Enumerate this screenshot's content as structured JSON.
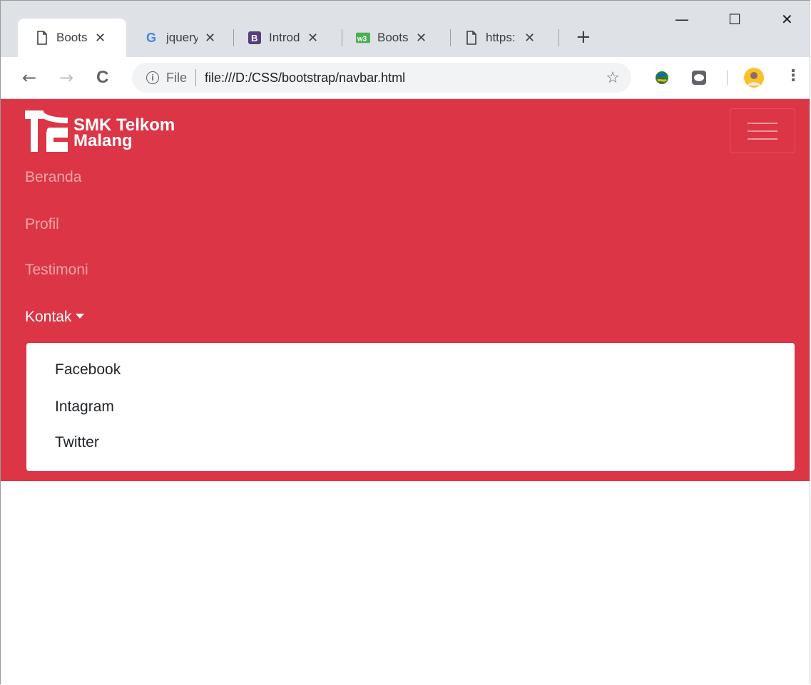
{
  "browser": {
    "tabs": [
      {
        "label": "Boots",
        "icon": "page-icon",
        "active": true
      },
      {
        "label": "jquery",
        "icon": "google-icon",
        "active": false
      },
      {
        "label": "Introd",
        "icon": "bootstrap-icon",
        "active": false
      },
      {
        "label": "Boots",
        "icon": "w3schools-icon",
        "active": false
      },
      {
        "label": "https:",
        "icon": "page-icon",
        "active": false
      }
    ],
    "tab_close": "✕",
    "new_tab": "+",
    "window_controls": {
      "minimize": "—",
      "maximize": "☐",
      "close": "✕"
    },
    "toolbar": {
      "back": "←",
      "forward": "→",
      "reload": "C",
      "info": "i",
      "scheme_label": "File",
      "url": "file:///D:/CSS/bootstrap/navbar.html",
      "bookmark": "☆",
      "menu": "⋮"
    }
  },
  "page": {
    "brand": {
      "line1": "SMK Telkom",
      "line2": "Malang"
    },
    "nav": [
      {
        "label": "Beranda",
        "active": false
      },
      {
        "label": "Profil",
        "active": false
      },
      {
        "label": "Testimoni",
        "active": false
      },
      {
        "label": "Kontak",
        "active": true
      }
    ],
    "dropdown": [
      "Facebook",
      "Intagram",
      "Twitter"
    ]
  },
  "colors": {
    "navbar": "#dc3545",
    "tabstrip": "#dee1e6",
    "omnibox": "#f1f3f4"
  }
}
